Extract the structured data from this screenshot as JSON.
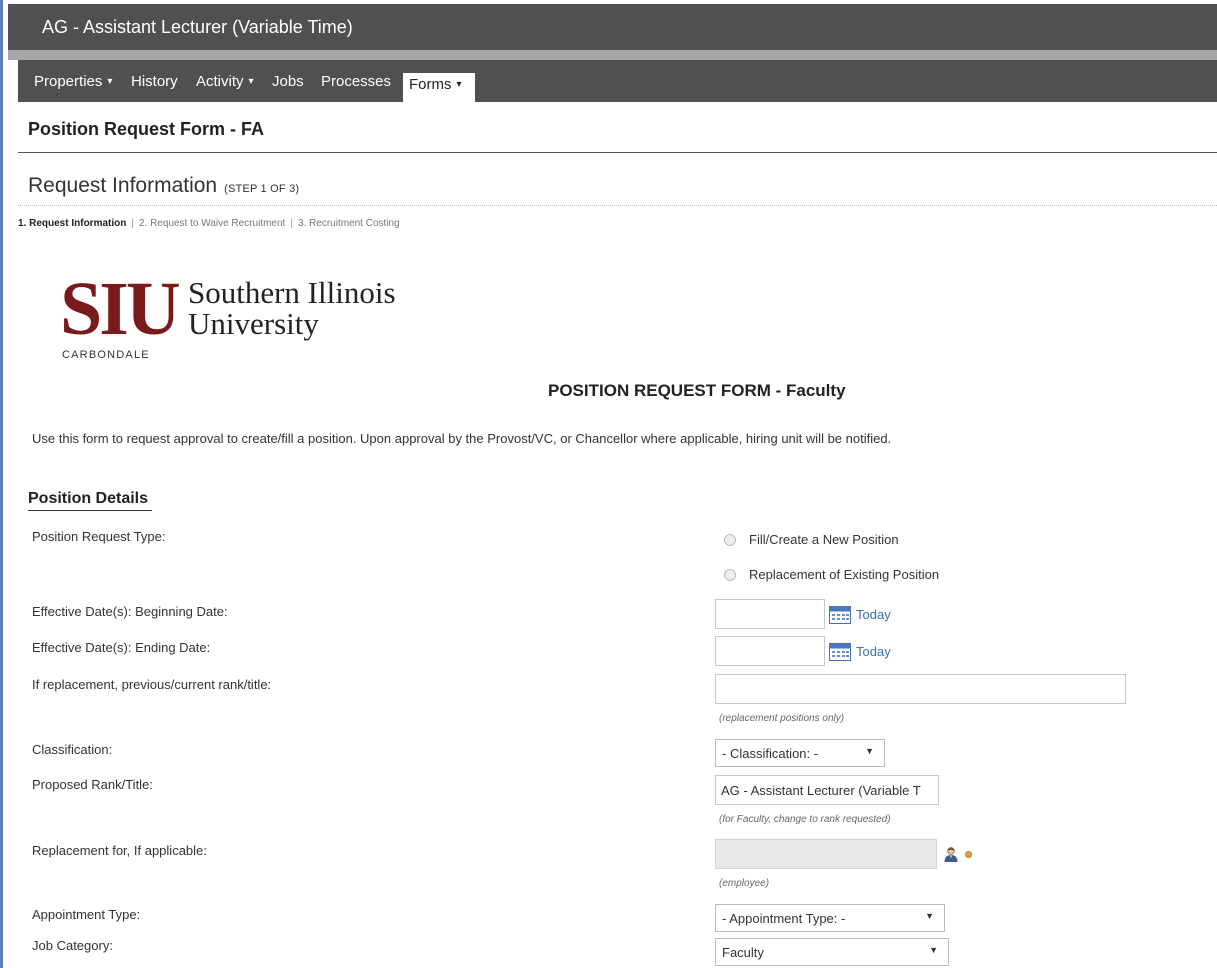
{
  "window": {
    "title": "AG - Assistant Lecturer (Variable Time)"
  },
  "nav": {
    "items": [
      {
        "label": "Properties",
        "dropdown": true
      },
      {
        "label": "History",
        "dropdown": false
      },
      {
        "label": "Activity",
        "dropdown": true
      },
      {
        "label": "Jobs",
        "dropdown": false
      },
      {
        "label": "Processes",
        "dropdown": false
      }
    ],
    "active": {
      "label": "Forms",
      "dropdown": true
    },
    "caret": "▾"
  },
  "page": {
    "title": "Position Request Form - FA",
    "section_title": "Request Information",
    "step_note": "(STEP 1 OF 3)",
    "steps": [
      "1. Request Information",
      "2. Request to Waive Recruitment",
      "3. Recruitment Costing"
    ],
    "step_separator": "|"
  },
  "logo": {
    "mark": "SIU",
    "name_line1": "Southern Illinois",
    "name_line2": "University",
    "campus": "CARBONDALE",
    "color": "#7a1a1a"
  },
  "form": {
    "heading": "POSITION REQUEST FORM - Faculty",
    "intro": "Use this form to request approval to create/fill a position. Upon approval by the Provost/VC, or Chancellor where applicable, hiring unit will be notified.",
    "section_heading": "Position Details",
    "today_label": "Today",
    "fields": {
      "request_type": {
        "label": "Position Request Type:",
        "options": [
          "Fill/Create a New Position",
          "Replacement of Existing Position"
        ]
      },
      "begin_date": {
        "label": "Effective Date(s): Beginning Date:",
        "value": ""
      },
      "end_date": {
        "label": "Effective Date(s): Ending Date:",
        "value": ""
      },
      "previous_rank": {
        "label": "If replacement, previous/current rank/title:",
        "value": "",
        "hint": "(replacement positions only)"
      },
      "classification": {
        "label": "Classification:",
        "selected": "- Classification: -"
      },
      "proposed_rank": {
        "label": "Proposed Rank/Title:",
        "value": "AG - Assistant Lecturer (Variable T",
        "hint": "(for Faculty, change to rank requested)"
      },
      "replacement_for": {
        "label": "Replacement for, If applicable:",
        "value": "",
        "hint": "(employee)"
      },
      "appointment_type": {
        "label": "Appointment Type:",
        "selected": "- Appointment Type: -"
      },
      "job_category": {
        "label": "Job Category:",
        "selected": "Faculty"
      }
    }
  },
  "icons": {
    "calendar": "calendar-icon",
    "person_lookup": "person-lookup-icon",
    "dropdown_arrow": "▼"
  },
  "colors": {
    "header_bg": "#505050",
    "link": "#3a6fb0",
    "required": "#ee9940"
  }
}
